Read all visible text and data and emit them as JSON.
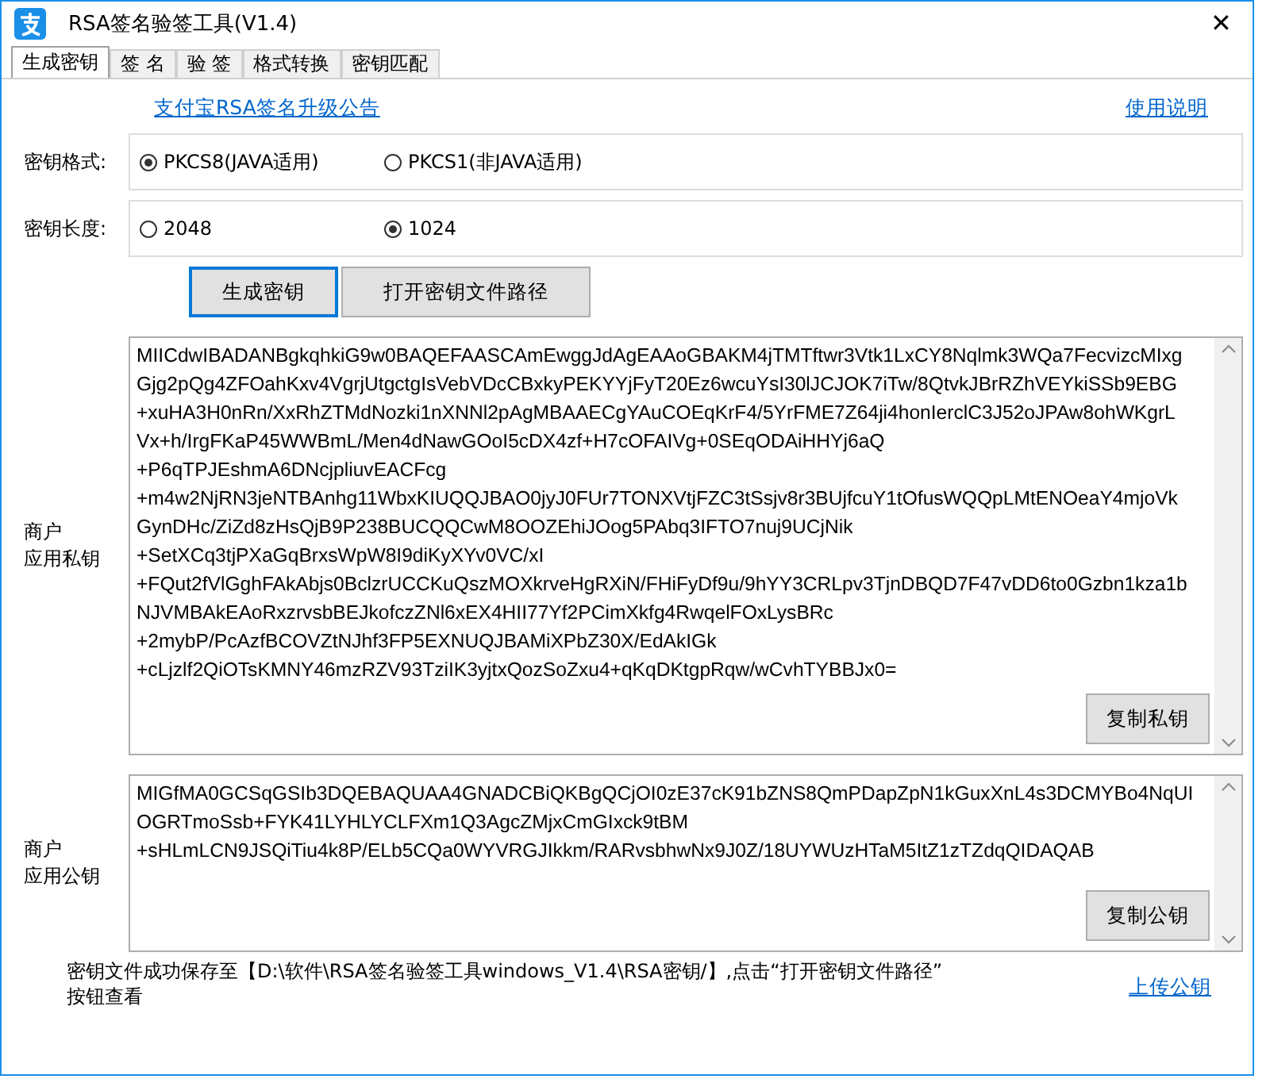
{
  "window": {
    "title": "RSA签名验签工具(V1.4)",
    "close": "✕"
  },
  "tabs": [
    {
      "label": "生成密钥",
      "selected": true
    },
    {
      "label": "签 名",
      "selected": false
    },
    {
      "label": "验 签",
      "selected": false
    },
    {
      "label": "格式转换",
      "selected": false
    },
    {
      "label": "密钥匹配",
      "selected": false
    }
  ],
  "notice_link": "支付宝RSA签名升级公告",
  "help_link": "使用说明",
  "option_groups": [
    {
      "label": "密钥格式:",
      "options": [
        {
          "label": "PKCS8(JAVA适用)",
          "selected": true
        },
        {
          "label": "PKCS1(非JAVA适用)",
          "selected": false
        }
      ]
    },
    {
      "label": "密钥长度:",
      "options": [
        {
          "label": "2048",
          "selected": false
        },
        {
          "label": "1024",
          "selected": true
        }
      ]
    }
  ],
  "actions": [
    {
      "label": "生成密钥",
      "focused": true
    },
    {
      "label": "打开密钥文件路径",
      "focused": false
    }
  ],
  "keys": [
    {
      "label": [
        "商户",
        "应用私钥"
      ],
      "button": "复制私钥",
      "lines": [
        "MIICdwIBADANBgkqhkiG9w0BAQEFAASCAmEwggJdAgEAAoGBAKM4jTMTftwr3Vtk1LxCY8Nqlmk3WQa7FecvizcMIxg",
        "Gjg2pQg4ZFOahKxv4VgrjUtgctgIsVebVDcCBxkyPEKYYjFyT20Ez6wcuYsI30lJCJOK7iTw/8QtvkJBrRZhVEYkiSSb9EBG",
        "+xuHA3H0nRn/XxRhZTMdNozki1nXNNl2pAgMBAAECgYAuCOEqKrF4/5YrFME7Z64ji4honIerclC3J52oJPAw8ohWKgrL",
        "Vx+h/IrgFKaP45WWBmL/Men4dNawGOoI5cDX4zf+H7cOFAIVg+0SEqODAiHHYj6aQ",
        "+P6qTPJEshmA6DNcjpliuvEACFcg",
        "+m4w2NjRN3jeNTBAnhg11WbxKIUQQJBAO0jyJ0FUr7TONXVtjFZC3tSsjv8r3BUjfcuY1tOfusWQQpLMtENOeaY4mjoVk",
        "GynDHc/ZiZd8zHsQjB9P238BUCQQCwM8OOZEhiJOog5PAbq3IFTO7nuj9UCjNik",
        "+SetXCq3tjPXaGqBrxsWpW8I9diKyXYv0VC/xI",
        "+FQut2fVlGghFAkAbjs0BclzrUCCKuQszMOXkrveHgRXiN/FHiFyDf9u/9hYY3CRLpv3TjnDBQD7F47vDD6to0Gzbn1kza1b",
        "NJVMBAkEAoRxzrvsbBEJkofczZNl6xEX4HII77Yf2PCimXkfg4RwqelFOxLysBRc",
        "+2mybP/PcAzfBCOVZtNJhf3FP5EXNUQJBAMiXPbZ30X/EdAkIGk",
        "+cLjzlf2QiOTsKMNY46mzRZV93TziIK3yjtxQozSoZxu4+qKqDKtgpRqw/wCvhTYBBJx0="
      ]
    },
    {
      "label": [
        "商户",
        "应用公钥"
      ],
      "button": "复制公钥",
      "lines": [
        "MIGfMA0GCSqGSIb3DQEBAQUAA4GNADCBiQKBgQCjOI0zE37cK91bZNS8QmPDapZpN1kGuxXnL4s3DCMYBo4NqUI",
        "OGRTmoSsb+FYK41LYHLYCLFXm1Q3AgcZMjxCmGIxck9tBM",
        "+sHLmLCN9JSQiTiu4k8P/ELb5CQa0WYVRGJIkkm/RARvsbhwNx9J0Z/18UYWUzHTaM5ItZ1zTZdqQIDAQAB"
      ]
    }
  ],
  "status": [
    "密钥文件成功保存至【D:\\软件\\RSA签名验签工具windows_V1.4\\RSA密钥/】,点击“打开密钥文件路径”",
    "按钮查看"
  ],
  "upload_link": "上传公钥"
}
